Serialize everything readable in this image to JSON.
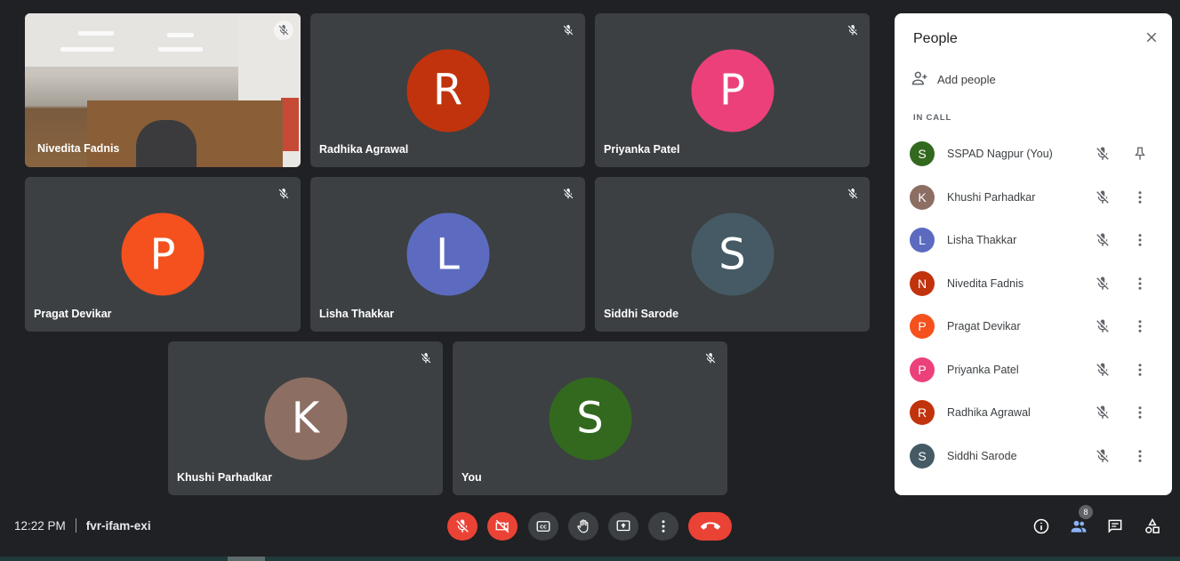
{
  "meeting": {
    "time": "12:22 PM",
    "code": "fvr-ifam-exi"
  },
  "tiles": [
    {
      "name": "Nivedita Fadnis",
      "initial": "",
      "color": "",
      "video": true
    },
    {
      "name": "Radhika Agrawal",
      "initial": "R",
      "color": "#c1330d"
    },
    {
      "name": "Priyanka Patel",
      "initial": "P",
      "color": "#ec407a"
    },
    {
      "name": "Pragat Devikar",
      "initial": "P",
      "color": "#f4511e"
    },
    {
      "name": "Lisha Thakkar",
      "initial": "L",
      "color": "#5c6bc0"
    },
    {
      "name": "Siddhi Sarode",
      "initial": "S",
      "color": "#455a64"
    },
    {
      "name": "Khushi Parhadkar",
      "initial": "K",
      "color": "#8d6e63"
    },
    {
      "name": "You",
      "initial": "S",
      "color": "#33691e"
    }
  ],
  "panel": {
    "title": "People",
    "add_people": "Add people",
    "in_call_label": "IN CALL",
    "participants": [
      {
        "name": "SSPAD Nagpur (You)",
        "initial": "S",
        "color": "#33691e",
        "action_icon": "pin-icon"
      },
      {
        "name": "Khushi Parhadkar",
        "initial": "K",
        "color": "#8d6e63",
        "action_icon": "more-options-icon"
      },
      {
        "name": "Lisha Thakkar",
        "initial": "L",
        "color": "#5c6bc0",
        "action_icon": "more-options-icon"
      },
      {
        "name": "Nivedita Fadnis",
        "initial": "N",
        "color": "#c1330d",
        "action_icon": "more-options-icon"
      },
      {
        "name": "Pragat Devikar",
        "initial": "P",
        "color": "#f4511e",
        "action_icon": "more-options-icon"
      },
      {
        "name": "Priyanka Patel",
        "initial": "P",
        "color": "#ec407a",
        "action_icon": "more-options-icon"
      },
      {
        "name": "Radhika Agrawal",
        "initial": "R",
        "color": "#c1330d",
        "action_icon": "more-options-icon"
      },
      {
        "name": "Siddhi Sarode",
        "initial": "S",
        "color": "#455a64",
        "action_icon": "more-options-icon"
      }
    ]
  },
  "controls": {
    "participant_count": "8",
    "buttons": [
      "mic-off-icon",
      "camera-off-icon",
      "captions-icon",
      "raise-hand-icon",
      "present-icon",
      "more-options-icon",
      "hang-up-icon"
    ],
    "right_icons": [
      "info-icon",
      "people-icon",
      "chat-icon",
      "activities-icon"
    ]
  },
  "colors": {
    "background": "#202124",
    "tile": "#3c4043",
    "danger": "#ea4335"
  }
}
